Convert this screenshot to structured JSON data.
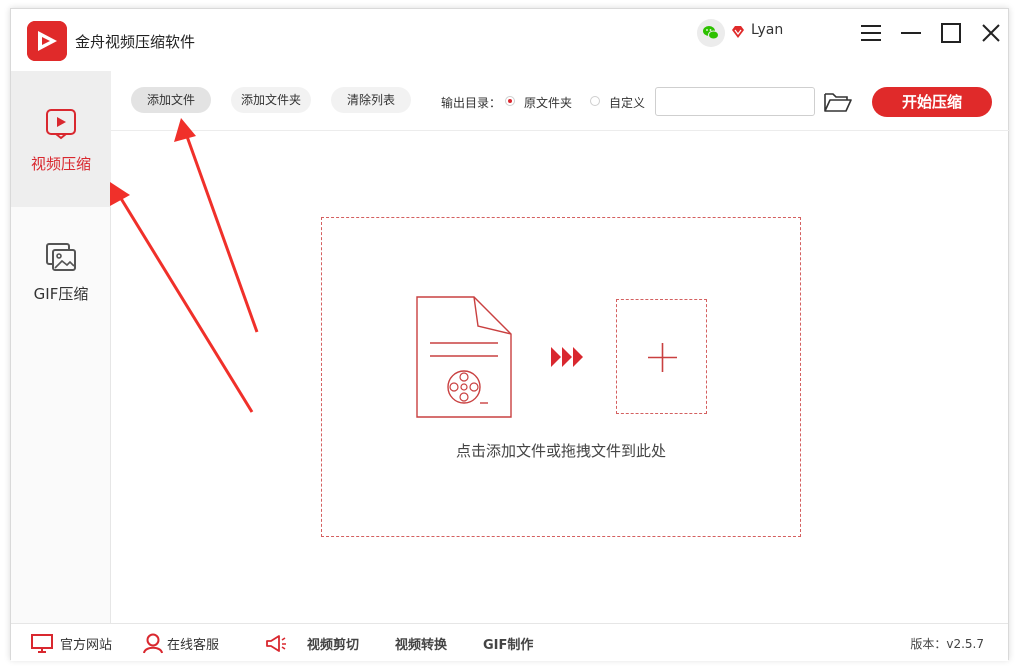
{
  "app": {
    "title": "金舟视频压缩软件",
    "brand_color": "#e02a2a",
    "accent_color": "#d9282f"
  },
  "user": {
    "name": "Lyan",
    "login_icon": "wechat-icon",
    "vip_icon": "vip-diamond-icon"
  },
  "window_controls": [
    "menu-icon",
    "minimize-icon",
    "maximize-icon",
    "close-icon"
  ],
  "sidebar": {
    "items": [
      {
        "label": "视频压缩",
        "icon": "video-play-icon",
        "active": true
      },
      {
        "label": "GIF压缩",
        "icon": "image-gallery-icon",
        "active": false
      }
    ]
  },
  "toolbar": {
    "add_file": "添加文件",
    "add_folder": "添加文件夹",
    "clear_list": "清除列表",
    "output_label": "输出目录：",
    "output_options": [
      {
        "label": "原文件夹",
        "checked": true
      },
      {
        "label": "自定义",
        "checked": false
      }
    ],
    "output_path_value": "",
    "folder_icon": "folder-open-icon",
    "start_label": "开始压缩"
  },
  "dropzone": {
    "hint": "点击添加文件或拖拽文件到此处",
    "doc_icon": "video-document-icon",
    "arrow_icon": "triple-arrow-icon",
    "add_icon": "plus-icon"
  },
  "footer": {
    "website": "官方网站",
    "support": "在线客服",
    "promo_icon": "megaphone-icon",
    "links": [
      "视频剪切",
      "视频转换",
      "GIF制作"
    ],
    "version": "版本：v2.5.7"
  }
}
